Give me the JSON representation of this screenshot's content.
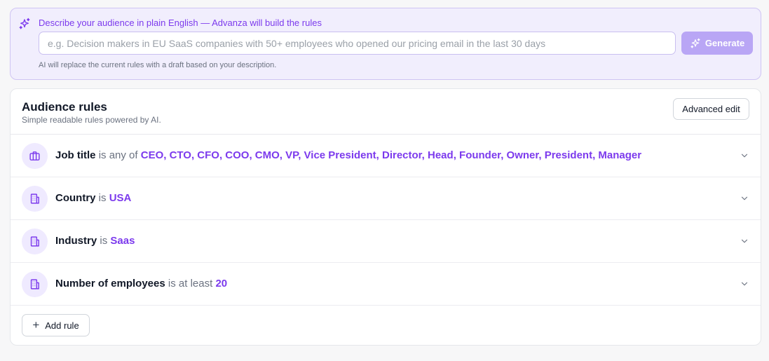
{
  "ai_prompt": {
    "title": "Describe your audience in plain English — Advanza will build the rules",
    "input_value": "",
    "input_placeholder": "e.g. Decision makers in EU SaaS companies with 50+ employees who opened our pricing email in the last 30 days",
    "generate_label": "Generate",
    "hint": "AI will replace the current rules with a draft based on your description.",
    "icon": "sparkles-icon"
  },
  "rules_card": {
    "title": "Audience rules",
    "subtitle": "Simple readable rules powered by AI.",
    "advanced_edit_label": "Advanced edit",
    "add_rule_label": "Add rule",
    "rules": [
      {
        "field": "Job title",
        "operator": "is any of",
        "value": "CEO, CTO, CFO, COO, CMO, VP, Vice President, Director, Head, Founder, Owner, President, Manager",
        "icon": "briefcase-icon"
      },
      {
        "field": "Country",
        "operator": "is",
        "value": "USA",
        "icon": "building-icon"
      },
      {
        "field": "Industry",
        "operator": "is",
        "value": "Saas",
        "icon": "building-icon"
      },
      {
        "field": "Number of employees",
        "operator": "is at least",
        "value": "20",
        "icon": "building-icon"
      }
    ]
  },
  "colors": {
    "accent": "#7c3aed",
    "panel_bg": "#f1eefd",
    "generate_bg": "#b9a6f5"
  }
}
